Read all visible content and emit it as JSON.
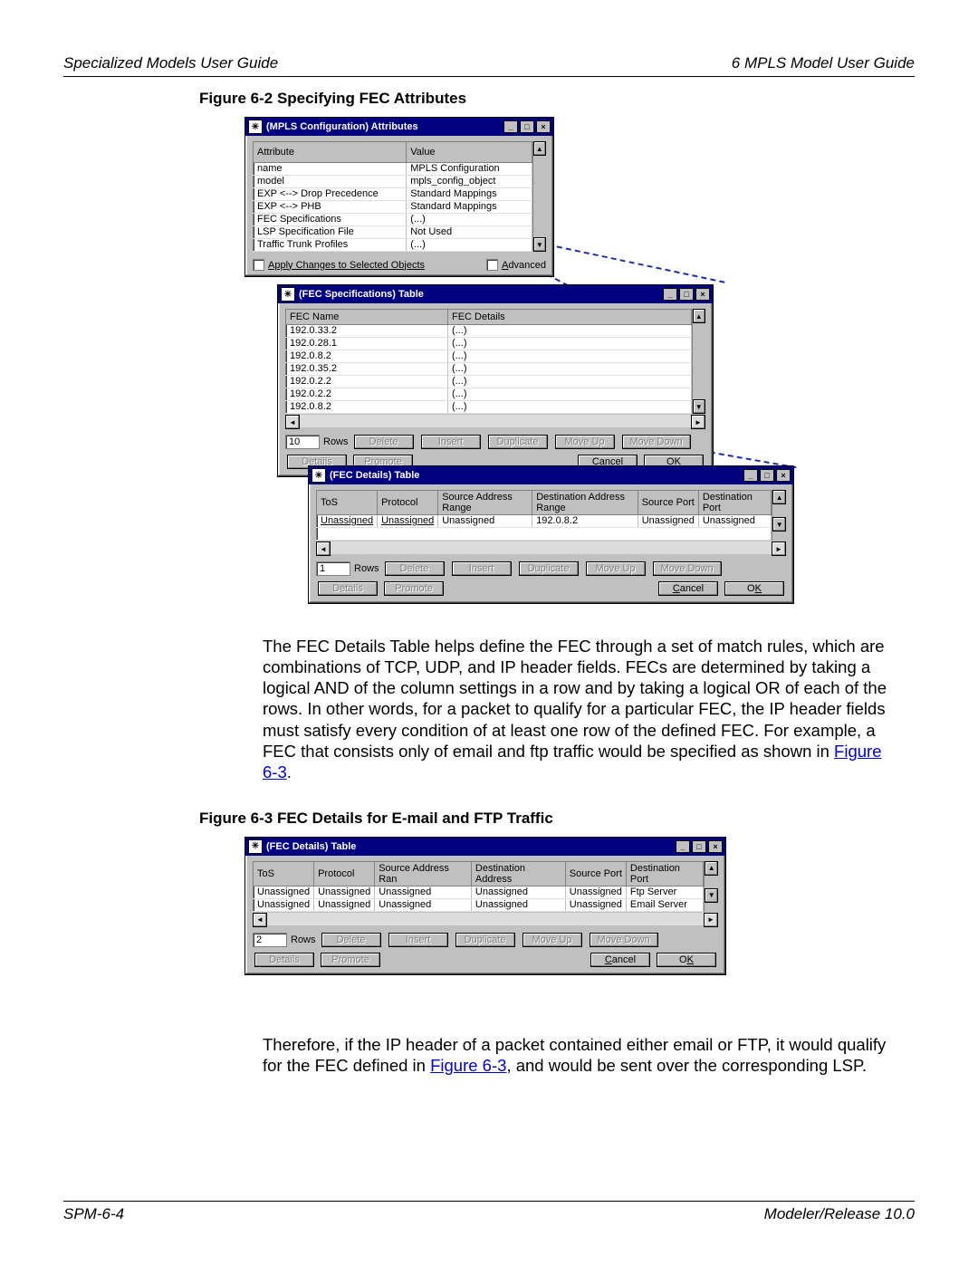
{
  "header": {
    "left": "Specialized Models User Guide",
    "right": "6   MPLS Model User Guide"
  },
  "figure62_caption": "Figure 6-2   Specifying FEC Attributes",
  "dlg1": {
    "title": "(MPLS Configuration) Attributes",
    "head_attr": "Attribute",
    "head_val": "Value",
    "rows": [
      {
        "a": "name",
        "v": "MPLS Configuration"
      },
      {
        "a": "model",
        "v": "mpls_config_object"
      },
      {
        "a": "EXP <--> Drop Precedence",
        "v": "Standard Mappings"
      },
      {
        "a": "EXP <--> PHB",
        "v": "Standard Mappings"
      },
      {
        "a": "FEC Specifications",
        "v": "(...)"
      },
      {
        "a": "LSP Specification File",
        "v": "Not Used"
      },
      {
        "a": "Traffic Trunk Profiles",
        "v": "(...)"
      }
    ],
    "apply_chk": "Apply Changes to Selected Objects",
    "advanced": "Advanced"
  },
  "dlg2": {
    "title": "(FEC Specifications) Table",
    "head_name": "FEC Name",
    "head_details": "FEC Details",
    "rows": [
      {
        "n": "192.0.33.2",
        "d": "(...)"
      },
      {
        "n": "192.0.28.1",
        "d": "(...)"
      },
      {
        "n": "192.0.8.2",
        "d": "(...)"
      },
      {
        "n": "192.0.35.2",
        "d": "(...)"
      },
      {
        "n": "192.0.2.2",
        "d": "(...)"
      },
      {
        "n": "192.0.2.2",
        "d": "(...)"
      },
      {
        "n": "192.0.8.2",
        "d": "(...)"
      }
    ],
    "rows_value": "10",
    "rows_label": "Rows"
  },
  "dlg3": {
    "title": "(FEC Details) Table",
    "cols": [
      "ToS",
      "Protocol",
      "Source Address Range",
      "Destination Address Range",
      "Source Port",
      "Destination Port"
    ],
    "row": {
      "tos": "Unassigned",
      "proto": "Unassigned",
      "src": "Unassigned",
      "dst": "192.0.8.2",
      "sport": "Unassigned",
      "dport": "Unassigned"
    },
    "rows_value": "1",
    "rows_label": "Rows"
  },
  "btns": {
    "delete": "Delete",
    "insert": "Insert",
    "duplicate": "Duplicate",
    "moveup": "Move Up",
    "movedown": "Move Down",
    "details": "Details",
    "promote": "Promote",
    "cancel": "Cancel",
    "ok": "OK"
  },
  "para1_a": "The FEC Details Table helps define the FEC through a set of match rules, which are combinations of TCP, UDP, and IP header fields. FECs are determined by taking a logical AND of the column settings in a row and by taking a logical OR of each of the rows. In other words, for a packet to qualify for a particular FEC, the IP header fields must satisfy every condition of at least one row of the defined FEC. For example, a FEC that consists only of email and ftp traffic would be specified as shown in ",
  "para1_link": "Figure 6-3",
  "para1_b": ".",
  "figure63_caption": "Figure 6-3   FEC Details for E-mail and FTP Traffic",
  "dlg4": {
    "title": "(FEC Details) Table",
    "cols": [
      "ToS",
      "Protocol",
      "Source Address Ran",
      "Destination Address",
      "Source Port",
      "Destination Port"
    ],
    "rows": [
      {
        "c": [
          "Unassigned",
          "Unassigned",
          "Unassigned",
          "Unassigned",
          "Unassigned",
          "Ftp Server"
        ]
      },
      {
        "c": [
          "Unassigned",
          "Unassigned",
          "Unassigned",
          "Unassigned",
          "Unassigned",
          "Email Server"
        ]
      }
    ],
    "rows_value": "2",
    "rows_label": "Rows"
  },
  "para2_a": "Therefore, if the IP header of a packet contained either email or FTP, it would qualify for the FEC defined in ",
  "para2_link": "Figure 6-3",
  "para2_b": ", and would be sent over the corresponding LSP.",
  "footer": {
    "left": "SPM-6-4",
    "right": "Modeler/Release 10.0"
  }
}
